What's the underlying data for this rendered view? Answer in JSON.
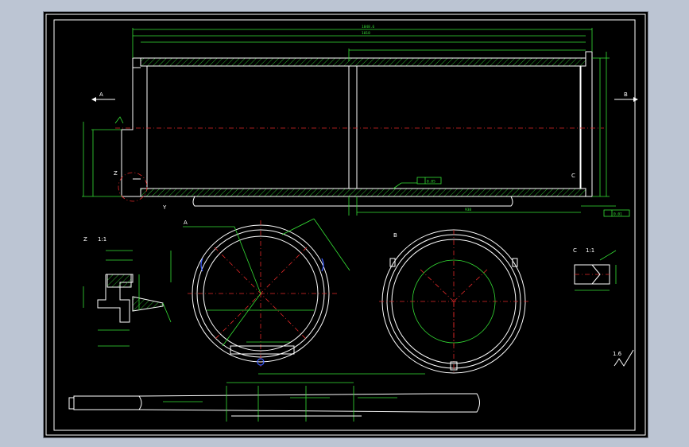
{
  "view_labels": {
    "section_a": "A",
    "section_b": "B",
    "detail_z": "Z",
    "detail_z_scale": "1:1",
    "detail_c": "C",
    "detail_c_scale": "1:1",
    "arrow_a": "A",
    "arrow_b": "B",
    "mark_y": "Y",
    "mark_z": "Z",
    "mark_c": "C"
  },
  "annotations": {
    "tolerance_frame_main": "0.05",
    "tolerance_frame_right": "0.01",
    "roughness_mark": "1.6",
    "dim_top_1": "1048.6",
    "dim_top_2": "1018",
    "dim_bottom_right": "938"
  },
  "colors": {
    "sheet": "#000000",
    "outline": "#ffffff",
    "dimension": "#35e035",
    "centerline": "#e02828",
    "hidden": "#e8e84a",
    "marker": "#3a5cff",
    "window": "#bcc5d3"
  }
}
